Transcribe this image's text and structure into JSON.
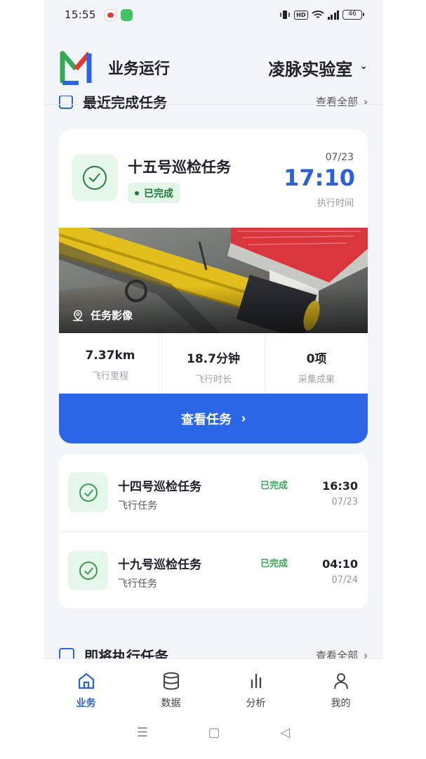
{
  "status_bar": {
    "time": "15:55",
    "battery": "46"
  },
  "header": {
    "brand": "业务运行",
    "lab": "凌脉实验室"
  },
  "recent_section": {
    "title": "最近完成任务",
    "view_all": "查看全部"
  },
  "featured_task": {
    "name": "十五号巡检任务",
    "status": "已完成",
    "date": "07/23",
    "time": "17:10",
    "time_label": "执行时间",
    "image_label": "任务影像",
    "stats": [
      {
        "value": "7.37km",
        "label": "飞行里程"
      },
      {
        "value": "18.7分钟",
        "label": "飞行时长"
      },
      {
        "value": "0项",
        "label": "采集成果"
      }
    ],
    "button": "查看任务"
  },
  "task_list": [
    {
      "name": "十四号巡检任务",
      "type": "飞行任务",
      "status": "已完成",
      "time": "16:30",
      "date": "07/23"
    },
    {
      "name": "十九号巡检任务",
      "type": "飞行任务",
      "status": "已完成",
      "time": "04:10",
      "date": "07/24"
    }
  ],
  "upcoming_section": {
    "title": "即将执行任务",
    "view_all": "查看全部"
  },
  "tabs": [
    {
      "label": "业务",
      "icon": "home-icon",
      "active": true
    },
    {
      "label": "数据",
      "icon": "database-icon",
      "active": false
    },
    {
      "label": "分析",
      "icon": "bar-chart-icon",
      "active": false
    },
    {
      "label": "我的",
      "icon": "user-icon",
      "active": false
    }
  ],
  "colors": {
    "accent": "#2a66e6",
    "success": "#1c7a34",
    "success_bg": "#e3f6e8"
  }
}
